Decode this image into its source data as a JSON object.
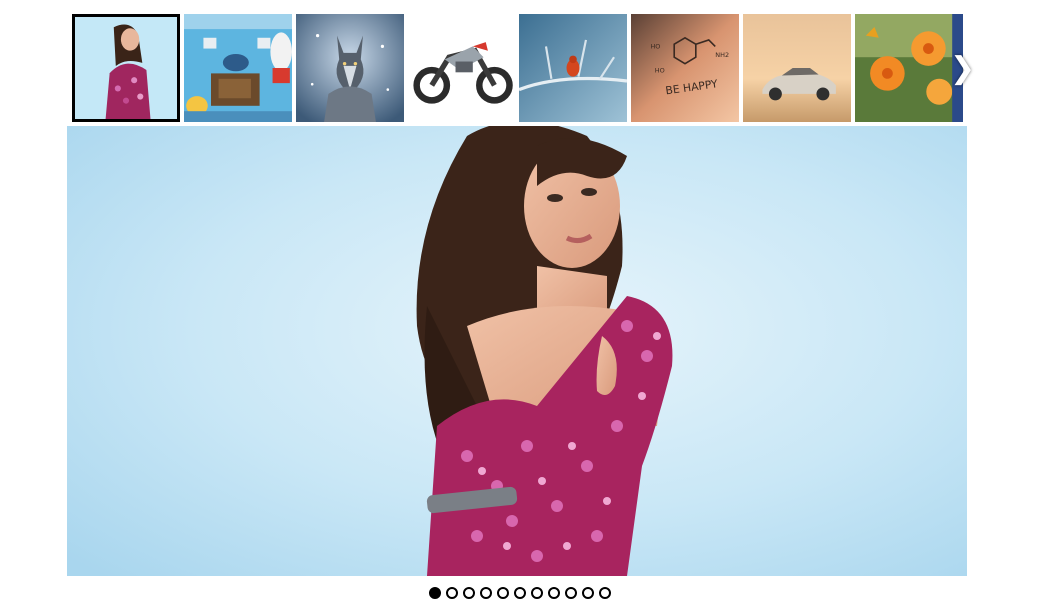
{
  "gallery": {
    "thumbnails": [
      {
        "name": "woman-pink-sequin-dress",
        "active": true
      },
      {
        "name": "cartoon-room-scene",
        "active": false
      },
      {
        "name": "wolf-in-snow",
        "active": false
      },
      {
        "name": "futuristic-motorcycle",
        "active": false
      },
      {
        "name": "bird-on-frozen-branch",
        "active": false
      },
      {
        "name": "dopamine-molecule-be-happy",
        "active": false
      },
      {
        "name": "sports-car-in-desert",
        "active": false
      },
      {
        "name": "orange-flowers-butterfly",
        "active": false
      }
    ],
    "thumb_text": {
      "be_happy": "BE HAPPY",
      "ho1": "HO",
      "ho2": "HO",
      "nh2": "NH2"
    },
    "next_icon": "chevron-right-icon",
    "next_glyph": "❯",
    "main_image": "woman-pink-sequin-dress",
    "slide_count": 11,
    "active_slide": 0
  },
  "colors": {
    "active_border": "#000000",
    "dot_fill": "#000000",
    "dot_empty": "#ffffff",
    "main_bg": "#c6e6f6"
  }
}
